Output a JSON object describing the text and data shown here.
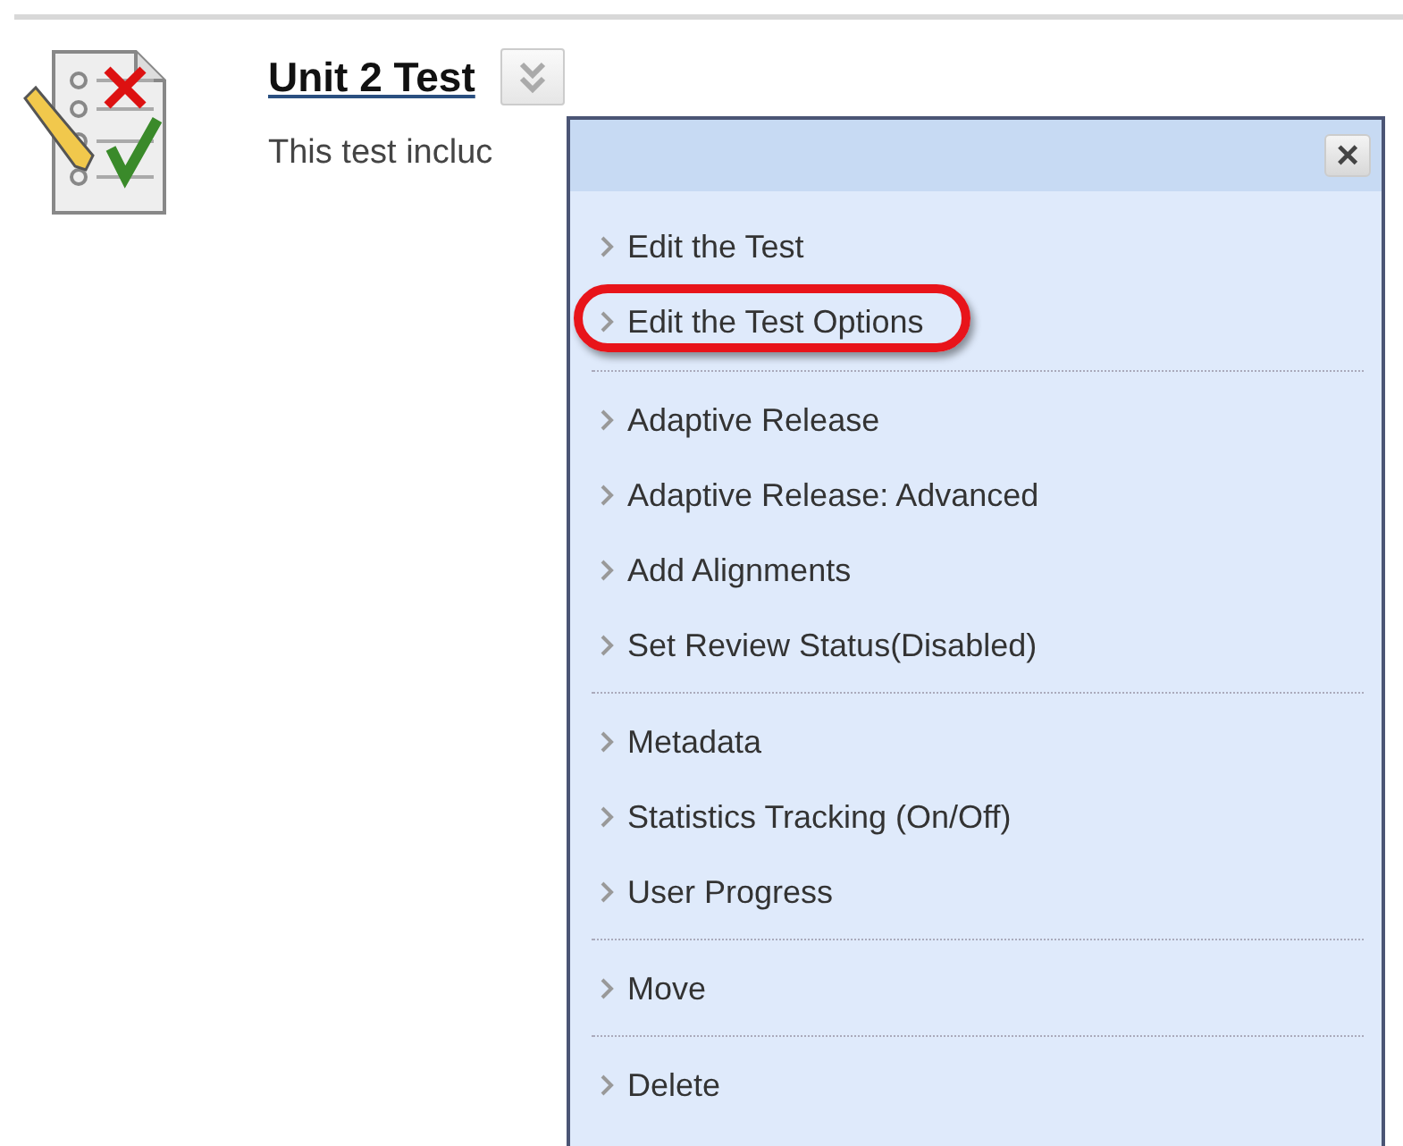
{
  "item": {
    "title": "Unit 2 Test",
    "description": "This test incluc"
  },
  "menu": {
    "close": "×",
    "sections": [
      {
        "items": [
          {
            "label": "Edit the Test",
            "highlighted": false
          },
          {
            "label": "Edit the Test Options",
            "highlighted": true
          }
        ]
      },
      {
        "items": [
          {
            "label": "Adaptive Release",
            "highlighted": false
          },
          {
            "label": "Adaptive Release: Advanced",
            "highlighted": false
          },
          {
            "label": "Add Alignments",
            "highlighted": false
          },
          {
            "label": "Set Review Status(Disabled)",
            "highlighted": false
          }
        ]
      },
      {
        "items": [
          {
            "label": "Metadata",
            "highlighted": false
          },
          {
            "label": "Statistics Tracking (On/Off)",
            "highlighted": false
          },
          {
            "label": "User Progress",
            "highlighted": false
          }
        ]
      },
      {
        "items": [
          {
            "label": "Move",
            "highlighted": false
          }
        ]
      },
      {
        "items": [
          {
            "label": "Delete",
            "highlighted": false
          }
        ]
      }
    ]
  }
}
